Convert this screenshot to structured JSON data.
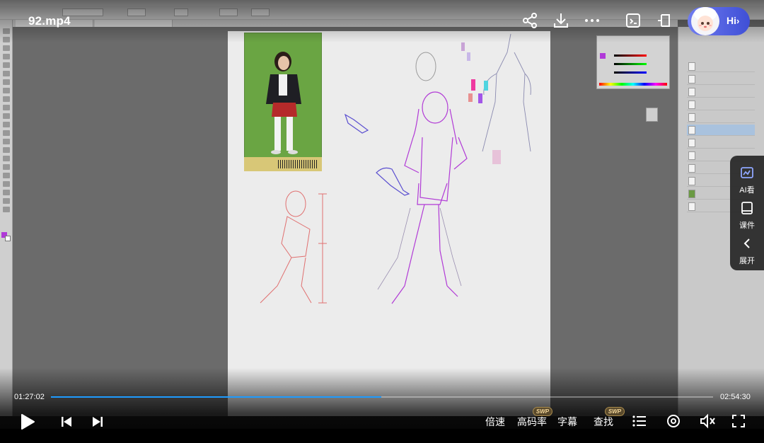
{
  "player": {
    "title": "92.mp4",
    "time_current": "01:27:02",
    "time_total": "02:54:30",
    "progress": 0.499,
    "accent_color": "#1e9bff"
  },
  "assistant": {
    "greeting": "Hi",
    "chevron": "›"
  },
  "top_actions": [
    {
      "icon": "share-icon"
    },
    {
      "icon": "download-icon"
    },
    {
      "icon": "more-icon"
    },
    {
      "icon": "screen-capture-icon"
    },
    {
      "icon": "pip-icon"
    }
  ],
  "side_panel": {
    "items": [
      {
        "label": "AI看",
        "icon": "ai-watch-icon"
      },
      {
        "label": "课件",
        "icon": "courseware-icon"
      },
      {
        "label": "展开",
        "icon": "collapse-left-icon"
      }
    ]
  },
  "controls": {
    "speed_label": "倍速",
    "quality_label": "高码率",
    "subtitle_label": "字幕",
    "search_label": "查找",
    "quality_badge": "SWP",
    "search_badge": "SWP"
  },
  "colors": {
    "badge_bg": "#5a4a2c",
    "badge_text": "#f4d79a",
    "assistant_bubble": "#4f5ce0"
  }
}
